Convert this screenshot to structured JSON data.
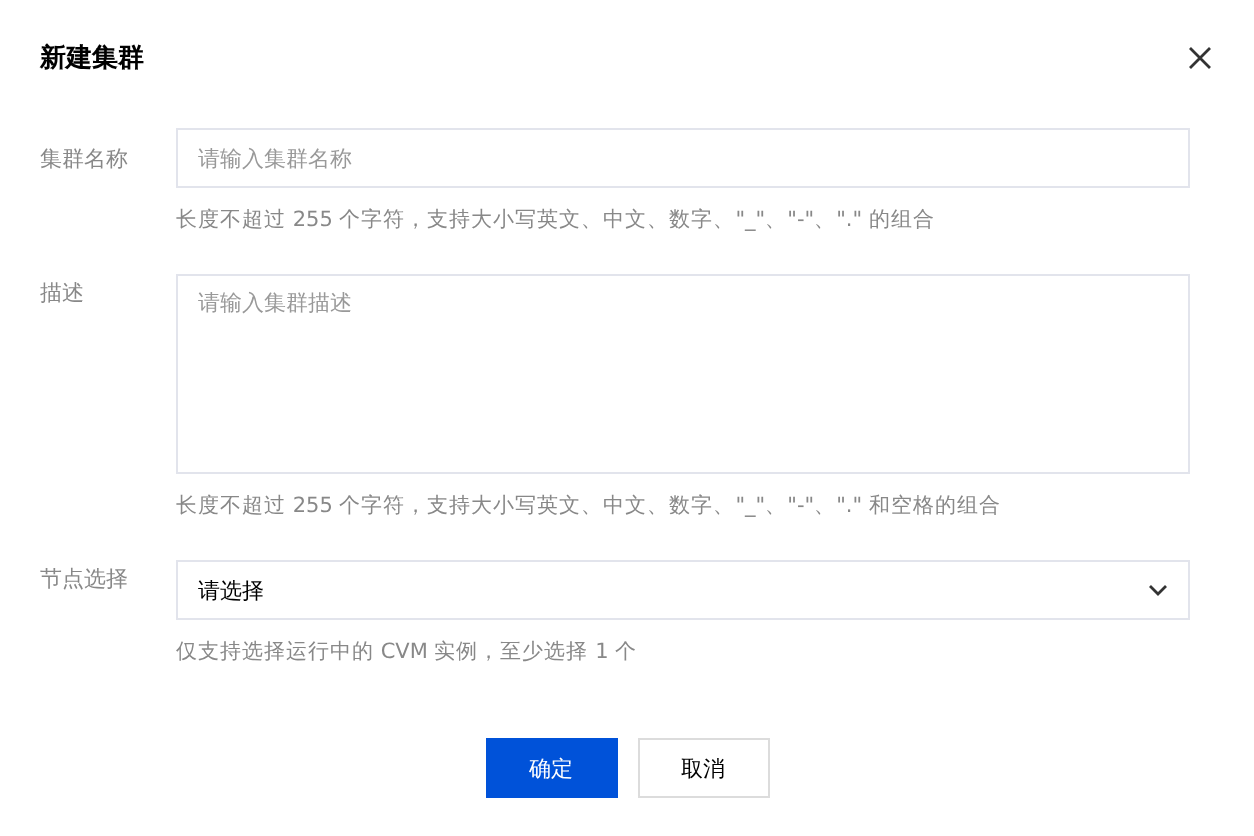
{
  "dialog": {
    "title": "新建集群"
  },
  "fields": [
    {
      "kind": "input",
      "label": "集群名称",
      "placeholder": "请输入集群名称",
      "hint": "长度不超过 255 个字符，支持大小写英文、中文、数字、\"_\"、\"-\"、\".\" 的组合"
    },
    {
      "kind": "textarea",
      "label": "描述",
      "placeholder": "请输入集群描述",
      "hint": "长度不超过 255 个字符，支持大小写英文、中文、数字、\"_\"、\"-\"、\".\" 和空格的组合"
    },
    {
      "kind": "select",
      "label": "节点选择",
      "value": "请选择",
      "hint": "仅支持选择运行中的 CVM 实例，至少选择 1 个"
    }
  ],
  "buttons": [
    {
      "kind": "primary",
      "label": "确定"
    },
    {
      "kind": "secondary",
      "label": "取消"
    }
  ]
}
